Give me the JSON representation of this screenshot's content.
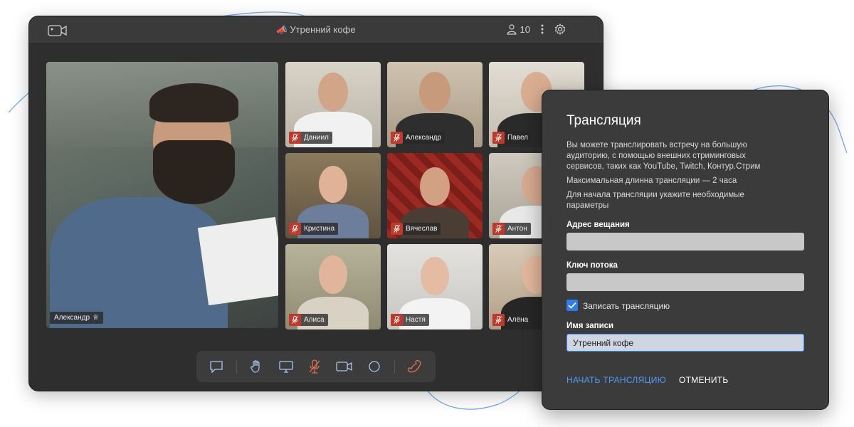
{
  "window": {
    "title": "Утренний кофе",
    "participants_count": "10"
  },
  "stage": {
    "name": "Александр"
  },
  "tiles": [
    {
      "name": "Даниил"
    },
    {
      "name": "Александр"
    },
    {
      "name": "Павел"
    },
    {
      "name": "Кристина"
    },
    {
      "name": "Вячеслав"
    },
    {
      "name": "Антон"
    },
    {
      "name": "Алиса"
    },
    {
      "name": "Настя"
    },
    {
      "name": "Алёна"
    }
  ],
  "dialog": {
    "title": "Трансляция",
    "description": "Вы можете транслировать встречу на большую аудиторию, с помощью внешних стриминговых сервисов, таких как YouTube, Twitch, Контур.Стрим",
    "max_duration": "Максимальная длинна трансляции — 2 часа",
    "instruction": "Для начала трансляции укажите необходимые параметры",
    "address_label": "Адрес вещания",
    "address_value": "",
    "key_label": "Ключ потока",
    "key_value": "",
    "record_label": "Записать трансляцию",
    "record_checked": true,
    "record_name_label": "Имя записи",
    "record_name_value": "Утренний кофе",
    "start_button": "НАЧАТЬ ТРАНСЛЯЦИЮ",
    "cancel_button": "ОТМЕНИТЬ"
  },
  "colors": {
    "accent": "#3d8bfd",
    "window_bg": "#2e2e2e",
    "dialog_bg": "#3b3b3b",
    "hangup": "#e07050",
    "mic_off": "#c0392b"
  }
}
